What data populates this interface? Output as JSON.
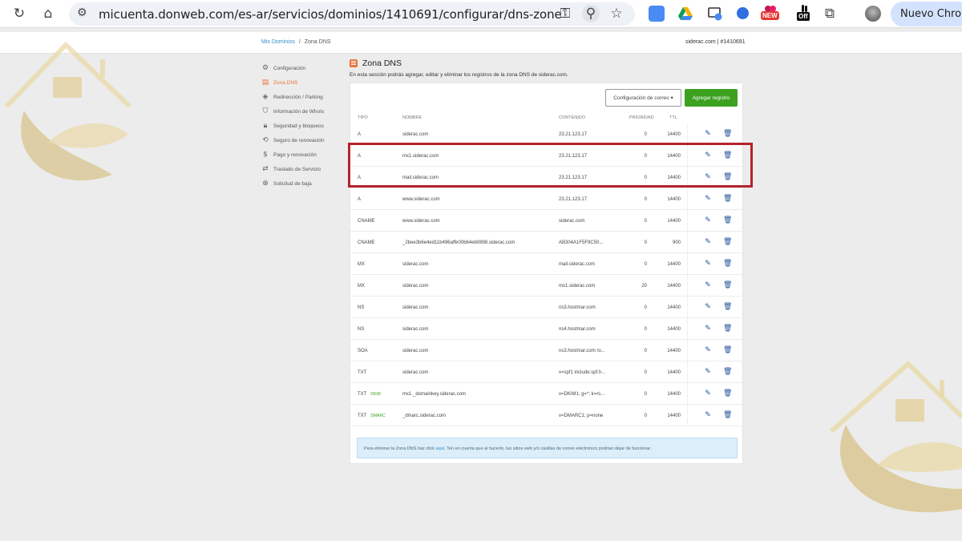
{
  "browser": {
    "url": "micuenta.donweb.com/es-ar/servicios/dominios/1410691/configurar/dns-zone",
    "new_badge": "NEW",
    "off_badge": "Off",
    "profile_button": "Nuevo Chrome"
  },
  "header": {
    "breadcrumb_root": "Mis Dominios",
    "breadcrumb_sep": "/",
    "breadcrumb_current": "Zona DNS",
    "account": "siderac.com | #1410691"
  },
  "sidebar": {
    "items": [
      {
        "label": "Configuración",
        "icon": "gear-icon"
      },
      {
        "label": "Zona DNS",
        "icon": "dns-zone-icon"
      },
      {
        "label": "Redirección / Parking",
        "icon": "redirect-icon"
      },
      {
        "label": "Información de WhoIs",
        "icon": "shield-icon"
      },
      {
        "label": "Seguridad y bloqueos",
        "icon": "lock-icon"
      },
      {
        "label": "Seguro de renovación",
        "icon": "history-icon"
      },
      {
        "label": "Pago y renovación",
        "icon": "dollar-icon"
      },
      {
        "label": "Traslado de Servicio",
        "icon": "transfer-icon"
      },
      {
        "label": "Solicitud de baja",
        "icon": "close-circle-icon"
      }
    ]
  },
  "main": {
    "title": "Zona DNS",
    "description": "En esta sección podrás agregar, editar y eliminar los registros de la zona DNS de siderac.com.",
    "mail_config_button": "Configuración de correo ▾",
    "add_record_button": "Agregar registro",
    "columns": {
      "type": "TIPO",
      "name": "NOMBRE",
      "content": "CONTENIDO",
      "priority": "PRIORIDAD",
      "ttl": "TTL"
    },
    "records": [
      {
        "type": "A",
        "tag": "",
        "name": "siderac.com",
        "content": "23.21.123.17",
        "priority": "0",
        "ttl": "14400"
      },
      {
        "type": "A",
        "tag": "",
        "name": "mx1.siderac.com",
        "content": "23.21.123.17",
        "priority": "0",
        "ttl": "14400"
      },
      {
        "type": "A",
        "tag": "",
        "name": "mail.siderac.com",
        "content": "23.21.123.17",
        "priority": "0",
        "ttl": "14400"
      },
      {
        "type": "A",
        "tag": "",
        "name": "www.siderac.com",
        "content": "23.21.123.17",
        "priority": "0",
        "ttl": "14400"
      },
      {
        "type": "CNAME",
        "tag": "",
        "name": "www.siderac.com",
        "content": "siderac.com",
        "priority": "0",
        "ttl": "14400"
      },
      {
        "type": "CNAME",
        "tag": "",
        "name": "_2bee3b6e4ed11b496affe00b64eb0898.siderac.com",
        "content": "AB304A1F5F9C50...",
        "priority": "0",
        "ttl": "900"
      },
      {
        "type": "MX",
        "tag": "",
        "name": "siderac.com",
        "content": "mail.siderac.com",
        "priority": "0",
        "ttl": "14400"
      },
      {
        "type": "MX",
        "tag": "",
        "name": "siderac.com",
        "content": "mx1.siderac.com",
        "priority": "20",
        "ttl": "14400"
      },
      {
        "type": "NS",
        "tag": "",
        "name": "siderac.com",
        "content": "ns3.hostmar.com",
        "priority": "0",
        "ttl": "14400"
      },
      {
        "type": "NS",
        "tag": "",
        "name": "siderac.com",
        "content": "ns4.hostmar.com",
        "priority": "0",
        "ttl": "14400"
      },
      {
        "type": "SOA",
        "tag": "",
        "name": "siderac.com",
        "content": "ns3.hostmar.com ro...",
        "priority": "0",
        "ttl": "14400"
      },
      {
        "type": "TXT",
        "tag": "",
        "name": "siderac.com",
        "content": "v=spf1 include:spf.h...",
        "priority": "0",
        "ttl": "14400"
      },
      {
        "type": "TXT",
        "tag": "DKIM",
        "name": "mx1._domainkey.siderac.com",
        "content": "v=DKIM1; g=*; k=rs...",
        "priority": "0",
        "ttl": "14400"
      },
      {
        "type": "TXT",
        "tag": "DMARC",
        "name": "_dmarc.siderac.com",
        "content": "v=DMARC1; p=none",
        "priority": "0",
        "ttl": "14400"
      }
    ],
    "notice_before": "Para eliminar la Zona DNS haz click",
    "notice_link": "aquí",
    "notice_after": ". Ten en cuenta que al hacerlo, tus sitios web y/o casillas de correo electrónico podrían dejar de funcionar."
  },
  "colors": {
    "accent_orange": "#e8743b",
    "add_button_green": "#3ca11f",
    "action_blue": "#1e4f9a",
    "highlight_red": "#b4232c",
    "watermark_gold": "#d9c48d"
  }
}
